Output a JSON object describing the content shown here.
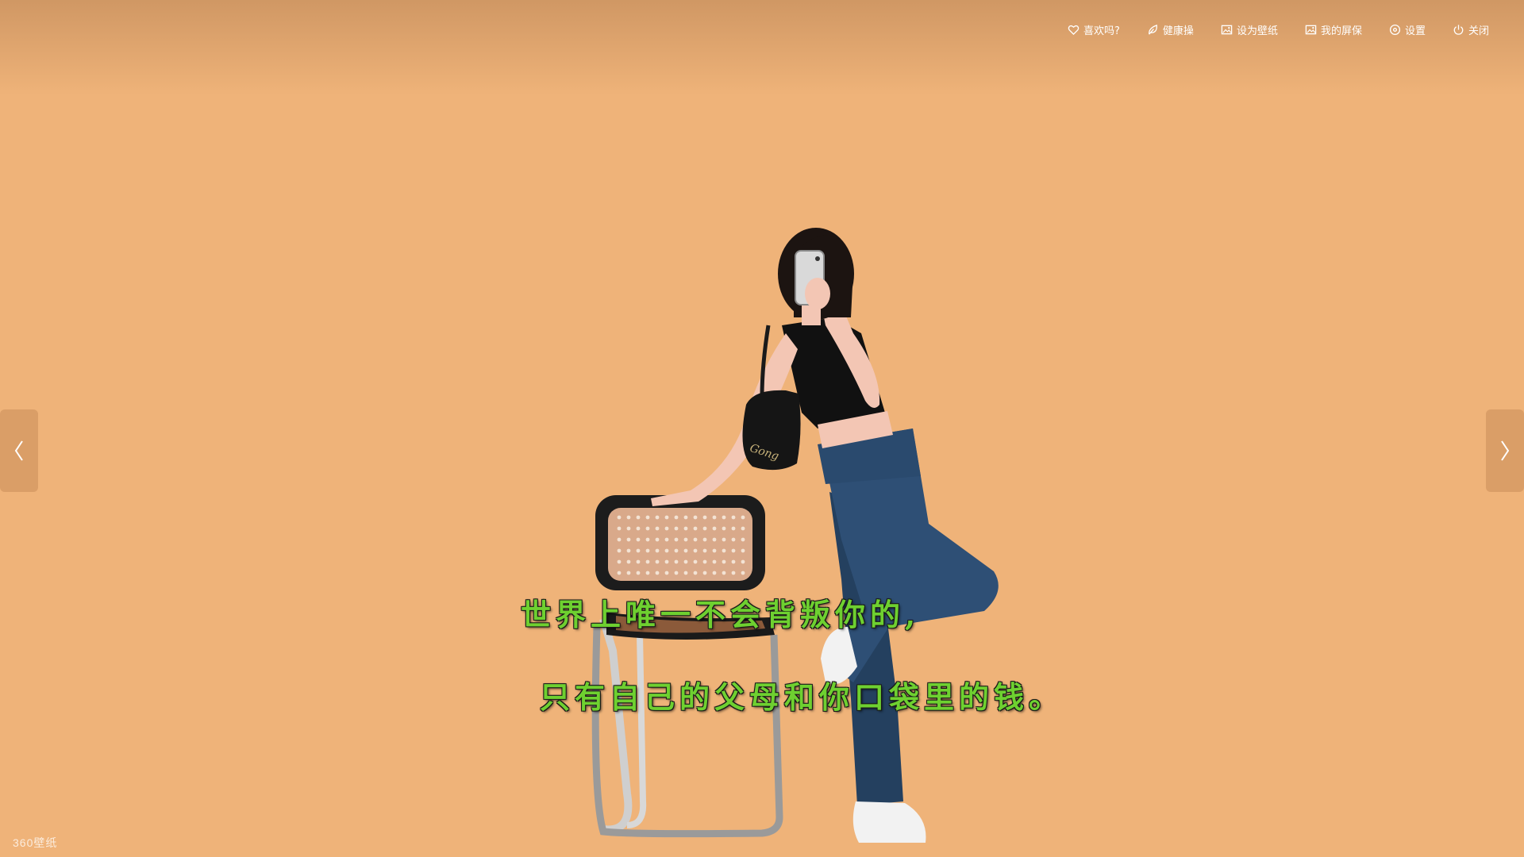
{
  "toolbar": {
    "like_label": "喜欢吗?",
    "health_label": "健康操",
    "wallpaper_label": "设为壁纸",
    "screensaver_label": "我的屏保",
    "settings_label": "设置",
    "close_label": "关闭"
  },
  "subtitle": {
    "line1": "世界上唯一不会背叛你的,",
    "line2": "只有自己的父母和你口袋里的钱。"
  },
  "watermark": "360壁纸",
  "bag_text": "Gong",
  "colors": {
    "background": "#efb379",
    "subtitle": "#6ed030",
    "toolbar_text": "#ffffff"
  },
  "icons": [
    "heart-icon",
    "leaf-icon",
    "image-icon",
    "image-icon",
    "settings-icon",
    "power-icon",
    "chevron-left-icon",
    "chevron-right-icon"
  ]
}
